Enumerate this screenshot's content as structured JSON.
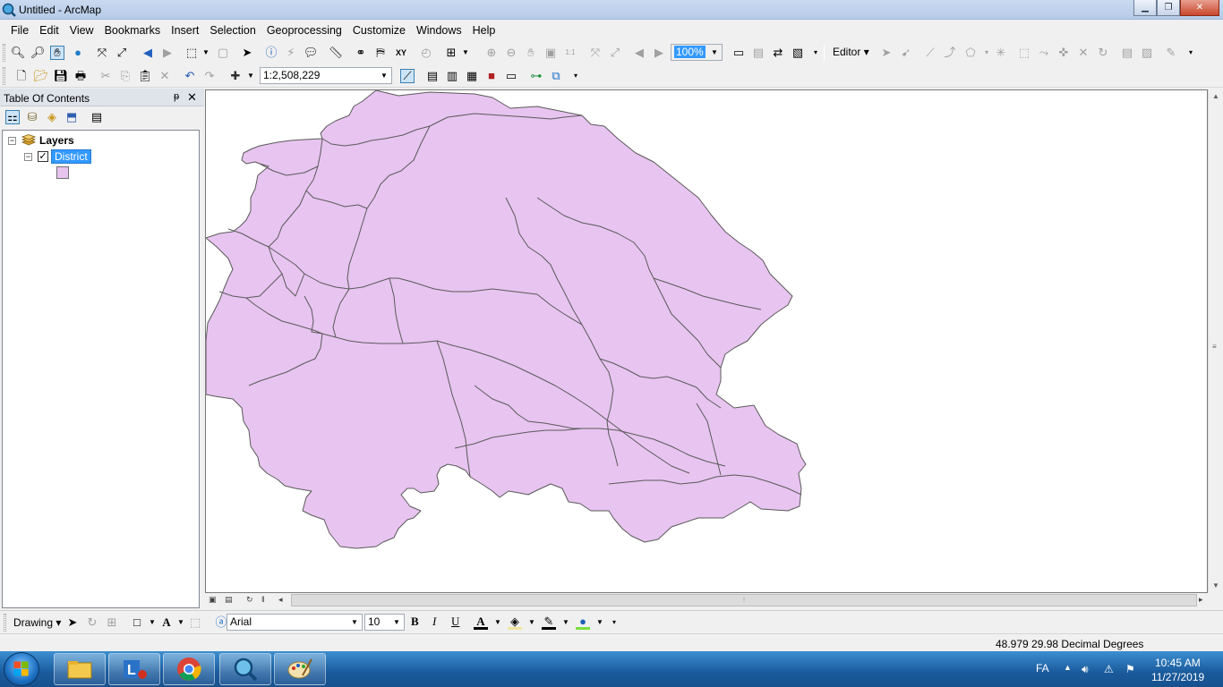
{
  "window": {
    "title": "Untitled - ArcMap",
    "minimize_glyph": "▁",
    "maximize_glyph": "❐",
    "close_glyph": "✕"
  },
  "menu": [
    "File",
    "Edit",
    "View",
    "Bookmarks",
    "Insert",
    "Selection",
    "Geoprocessing",
    "Customize",
    "Windows",
    "Help"
  ],
  "toolbar": {
    "scale_value": "1:2,508,229",
    "layout_zoom_value": "100%",
    "editor_label": "Editor"
  },
  "toc": {
    "title": "Table Of Contents",
    "pin_glyph": "ᵽ",
    "close_glyph": "✕",
    "data_frame_label": "Layers",
    "layer_label": "District",
    "layer_checked_glyph": "✓",
    "expander_glyph": "−"
  },
  "map": {
    "fill_color": "#e8c4f0",
    "outline_color": "#5a5a5a"
  },
  "drawing_toolbar": {
    "label": "Drawing",
    "font_name": "Arial",
    "font_size": "10",
    "bold": "B",
    "italic": "I",
    "underline": "U",
    "text_glyph": "A"
  },
  "status": {
    "coordinates": "48.979  29.98 Decimal Degrees"
  },
  "taskbar": {
    "language": "FA",
    "time": "10:45 AM",
    "date": "11/27/2019"
  }
}
